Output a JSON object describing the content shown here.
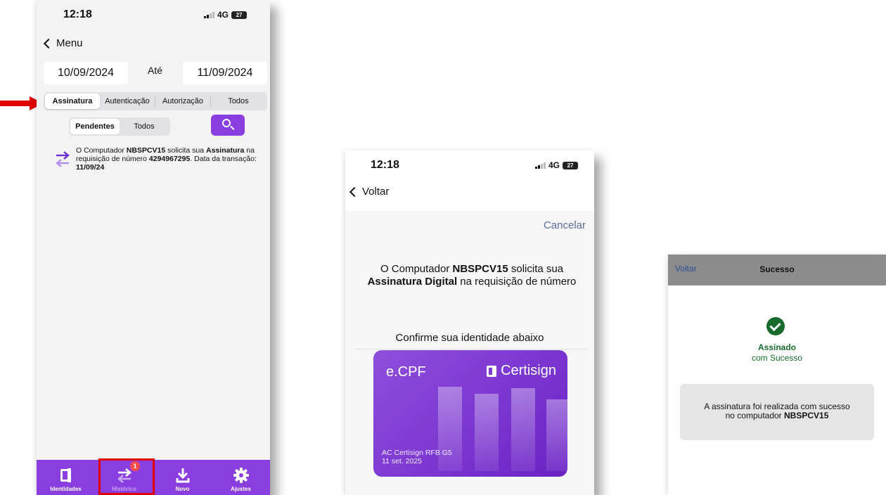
{
  "phone1": {
    "time": "12:18",
    "network": "4G",
    "battery": "27",
    "back_label": "Menu",
    "date_from": "10/09/2024",
    "date_to_label": "Até",
    "date_to": "11/09/2024",
    "type_tabs": [
      "Assinatura",
      "Autenticação",
      "Autorização",
      "Todos"
    ],
    "status_tabs": [
      "Pendentes",
      "Todos"
    ],
    "transaction": {
      "prefix": "O Computador ",
      "computer": "NBSPCV15",
      "mid": " solicita sua ",
      "type": "Assinatura",
      "mid2": " na requisição de número ",
      "number": "4294967295",
      "mid3": ". Data da transação: ",
      "date": "11/09/24"
    },
    "tabbar": [
      {
        "label": "Identidades",
        "icon": "id-card-icon"
      },
      {
        "label": "Histórico",
        "icon": "swap-arrows-icon",
        "badge": "1"
      },
      {
        "label": "Novo",
        "icon": "download-icon"
      },
      {
        "label": "Ajustes",
        "icon": "gear-icon"
      }
    ],
    "colors": {
      "accent": "#8a3ee0",
      "highlight": "#e10000"
    }
  },
  "phone2": {
    "time": "12:18",
    "network": "4G",
    "battery": "27",
    "back_label": "Voltar",
    "cancel_label": "Cancelar",
    "request": {
      "prefix": "O Computador ",
      "computer": "NBSPCV15",
      "mid": " solicita sua ",
      "type": "Assinatura Digital",
      "suffix": " na requisição de número"
    },
    "confirm_text": "Confirme sua identidade abaixo",
    "card": {
      "product": "e.CPF",
      "brand": "Certisign",
      "issuer": "AC Certisign RFB G5",
      "expiry": "11 set. 2025"
    }
  },
  "phone3": {
    "back_label": "Voltar",
    "title": "Sucesso",
    "status_main": "Assinado",
    "status_sub": "com Sucesso",
    "message_line1": "A assinatura foi realizada com sucesso",
    "message_prefix": "no computador ",
    "message_computer": "NBSPCV15",
    "colors": {
      "success": "#176c2d"
    }
  }
}
